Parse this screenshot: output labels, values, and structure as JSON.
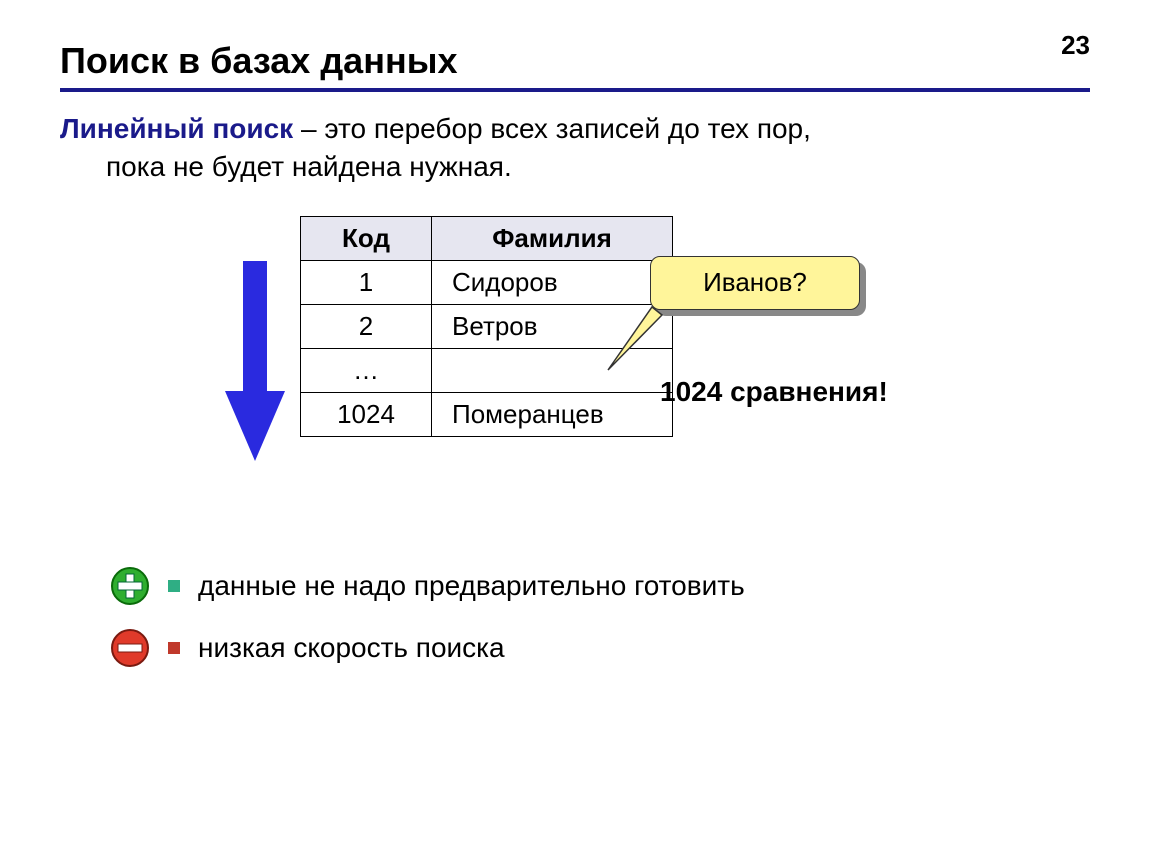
{
  "page_number": "23",
  "title": "Поиск в базах данных",
  "definition": {
    "term": "Линейный поиск",
    "rest_line1": " – это перебор всех записей до тех пор,",
    "rest_line2": "пока не будет найдена нужная."
  },
  "table": {
    "headers": {
      "code": "Код",
      "surname": "Фамилия"
    },
    "rows": [
      {
        "code": "1",
        "surname": "Сидоров"
      },
      {
        "code": "2",
        "surname": "Ветров"
      },
      {
        "code": "…",
        "surname": ""
      },
      {
        "code": "1024",
        "surname": "Померанцев"
      }
    ]
  },
  "callout": "Иванов?",
  "comparisons": "1024 сравнения!",
  "pros": "данные не надо предварительно готовить",
  "cons": "низкая скорость поиска"
}
